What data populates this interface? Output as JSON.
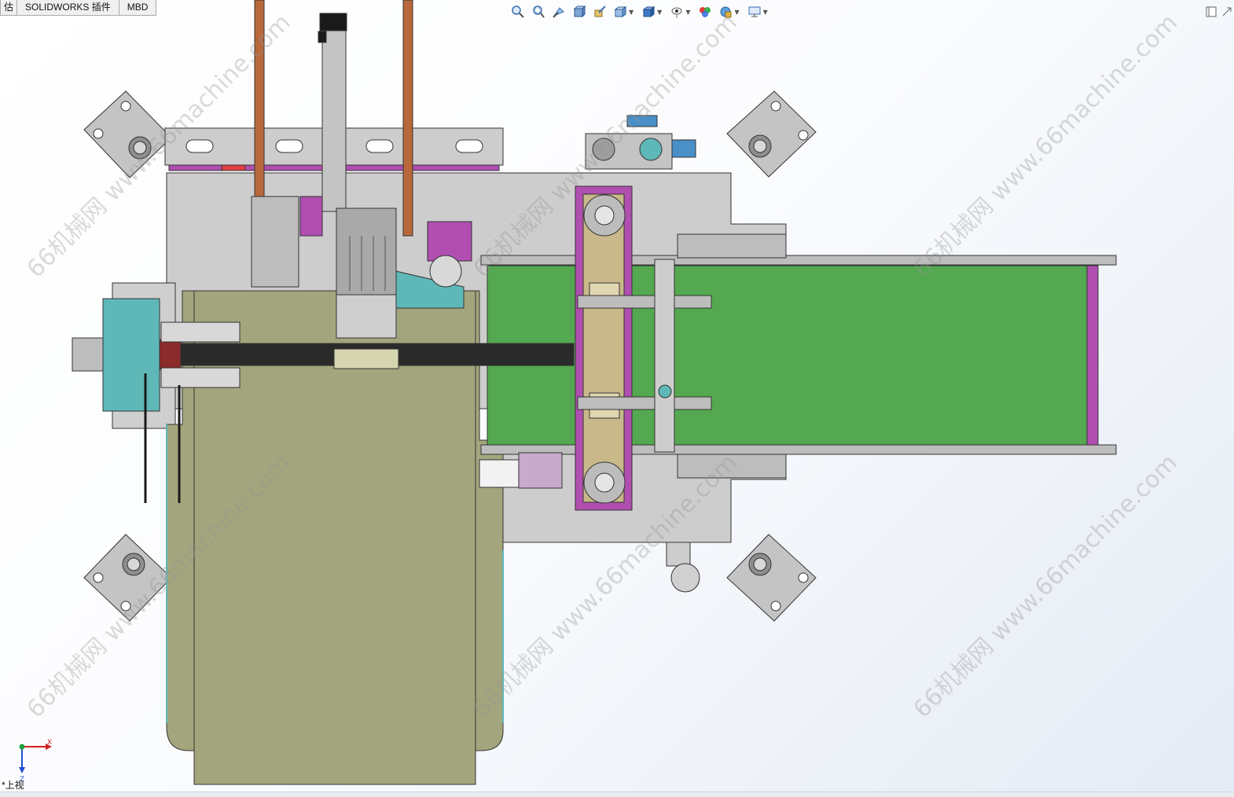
{
  "tabs": [
    {
      "label": "估"
    },
    {
      "label": "SOLIDWORKS 插件"
    },
    {
      "label": "MBD"
    }
  ],
  "view": {
    "label": "*上视"
  },
  "triad": {
    "x_label": "X",
    "z_label": "Z"
  },
  "watermarks": [
    {
      "text": "66机械网 www.66machine.com"
    },
    {
      "text": "66机械网 www.66machine.com"
    },
    {
      "text": "66机械网 www.66machine.com"
    },
    {
      "text": "66机械网 www.66machine.com"
    },
    {
      "text": "66机械网 www.66machine.com"
    },
    {
      "text": "66机械网 www.66machine.com"
    }
  ],
  "heads_up_toolbar": {
    "icons": [
      "zoom-to-fit-icon",
      "zoom-to-area-icon",
      "previous-view-icon",
      "section-view-icon",
      "dynamic-annotation-icon",
      "view-orientation-icon",
      "display-style-icon",
      "hide-show-icon",
      "edit-appearance-icon",
      "apply-scene-icon",
      "view-settings-icon"
    ]
  },
  "colors": {
    "frame_gray": "#c8c8c8",
    "tray_olive": "#a3a57c",
    "conveyor_green": "#54a850",
    "magenta": "#b04fb0",
    "teal": "#5fb8b8",
    "copper": "#b8683a"
  }
}
